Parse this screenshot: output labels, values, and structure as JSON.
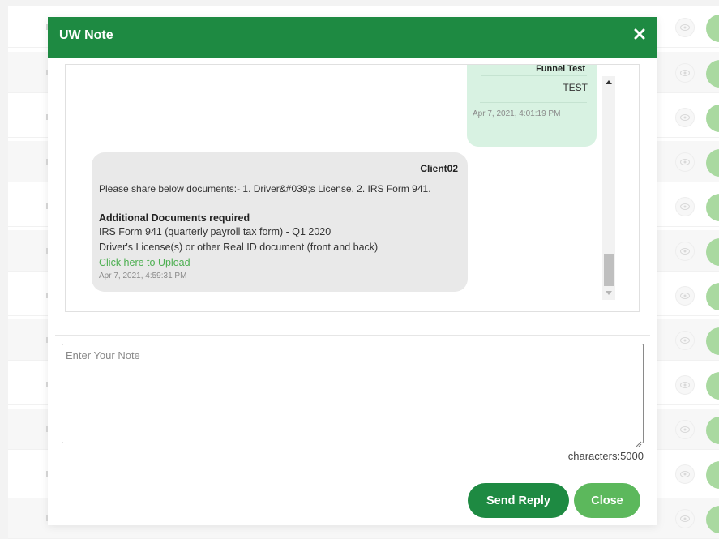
{
  "modal": {
    "title": "UW Note",
    "close_icon": "close-icon"
  },
  "messages": {
    "outgoing": {
      "sender": "Funnel Test",
      "text": "TEST",
      "timestamp": "Apr 7, 2021, 4:01:19 PM"
    },
    "incoming": {
      "sender": "Client02",
      "text": "Please share below documents:- 1. Driver&#039;s License. 2. IRS Form 941.",
      "additional_heading": "Additional Documents required",
      "documents": [
        "IRS Form 941 (quarterly payroll tax form) - Q1 2020",
        "Driver's License(s) or other Real ID document (front and back)"
      ],
      "upload_link": "Click here to Upload",
      "timestamp": "Apr 7, 2021, 4:59:31 PM"
    }
  },
  "note": {
    "placeholder": "Enter Your Note",
    "value": "",
    "char_count": "characters:5000"
  },
  "buttons": {
    "send_reply": "Send Reply",
    "close": "Close"
  },
  "colors": {
    "header_green": "#1e8a42",
    "close_button_green": "#5cb85c",
    "outgoing_bubble": "#d8f2e2",
    "incoming_bubble": "#e9e9e9",
    "link_green": "#4caf50"
  },
  "background_icons": {
    "row_action_icon": "eye-icon"
  }
}
